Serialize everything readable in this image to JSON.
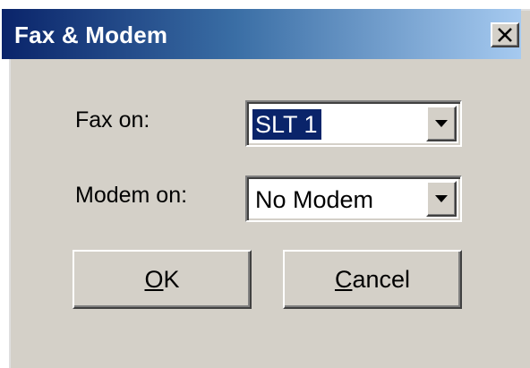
{
  "window": {
    "title": "Fax & Modem",
    "close_icon": "close-x-icon"
  },
  "form": {
    "fax": {
      "label": "Fax on:",
      "value": "SLT 1",
      "dropdown_icon": "chevron-down-icon"
    },
    "modem": {
      "label": "Modem on:",
      "value": "No Modem",
      "dropdown_icon": "chevron-down-icon"
    }
  },
  "buttons": {
    "ok": {
      "mnemonic": "O",
      "rest": "K"
    },
    "cancel": {
      "mnemonic": "C",
      "rest": "ancel"
    }
  },
  "colors": {
    "title_start": "#0a246a",
    "title_end": "#a6caf0",
    "face": "#d4d0c8",
    "selection": "#0a246a"
  }
}
